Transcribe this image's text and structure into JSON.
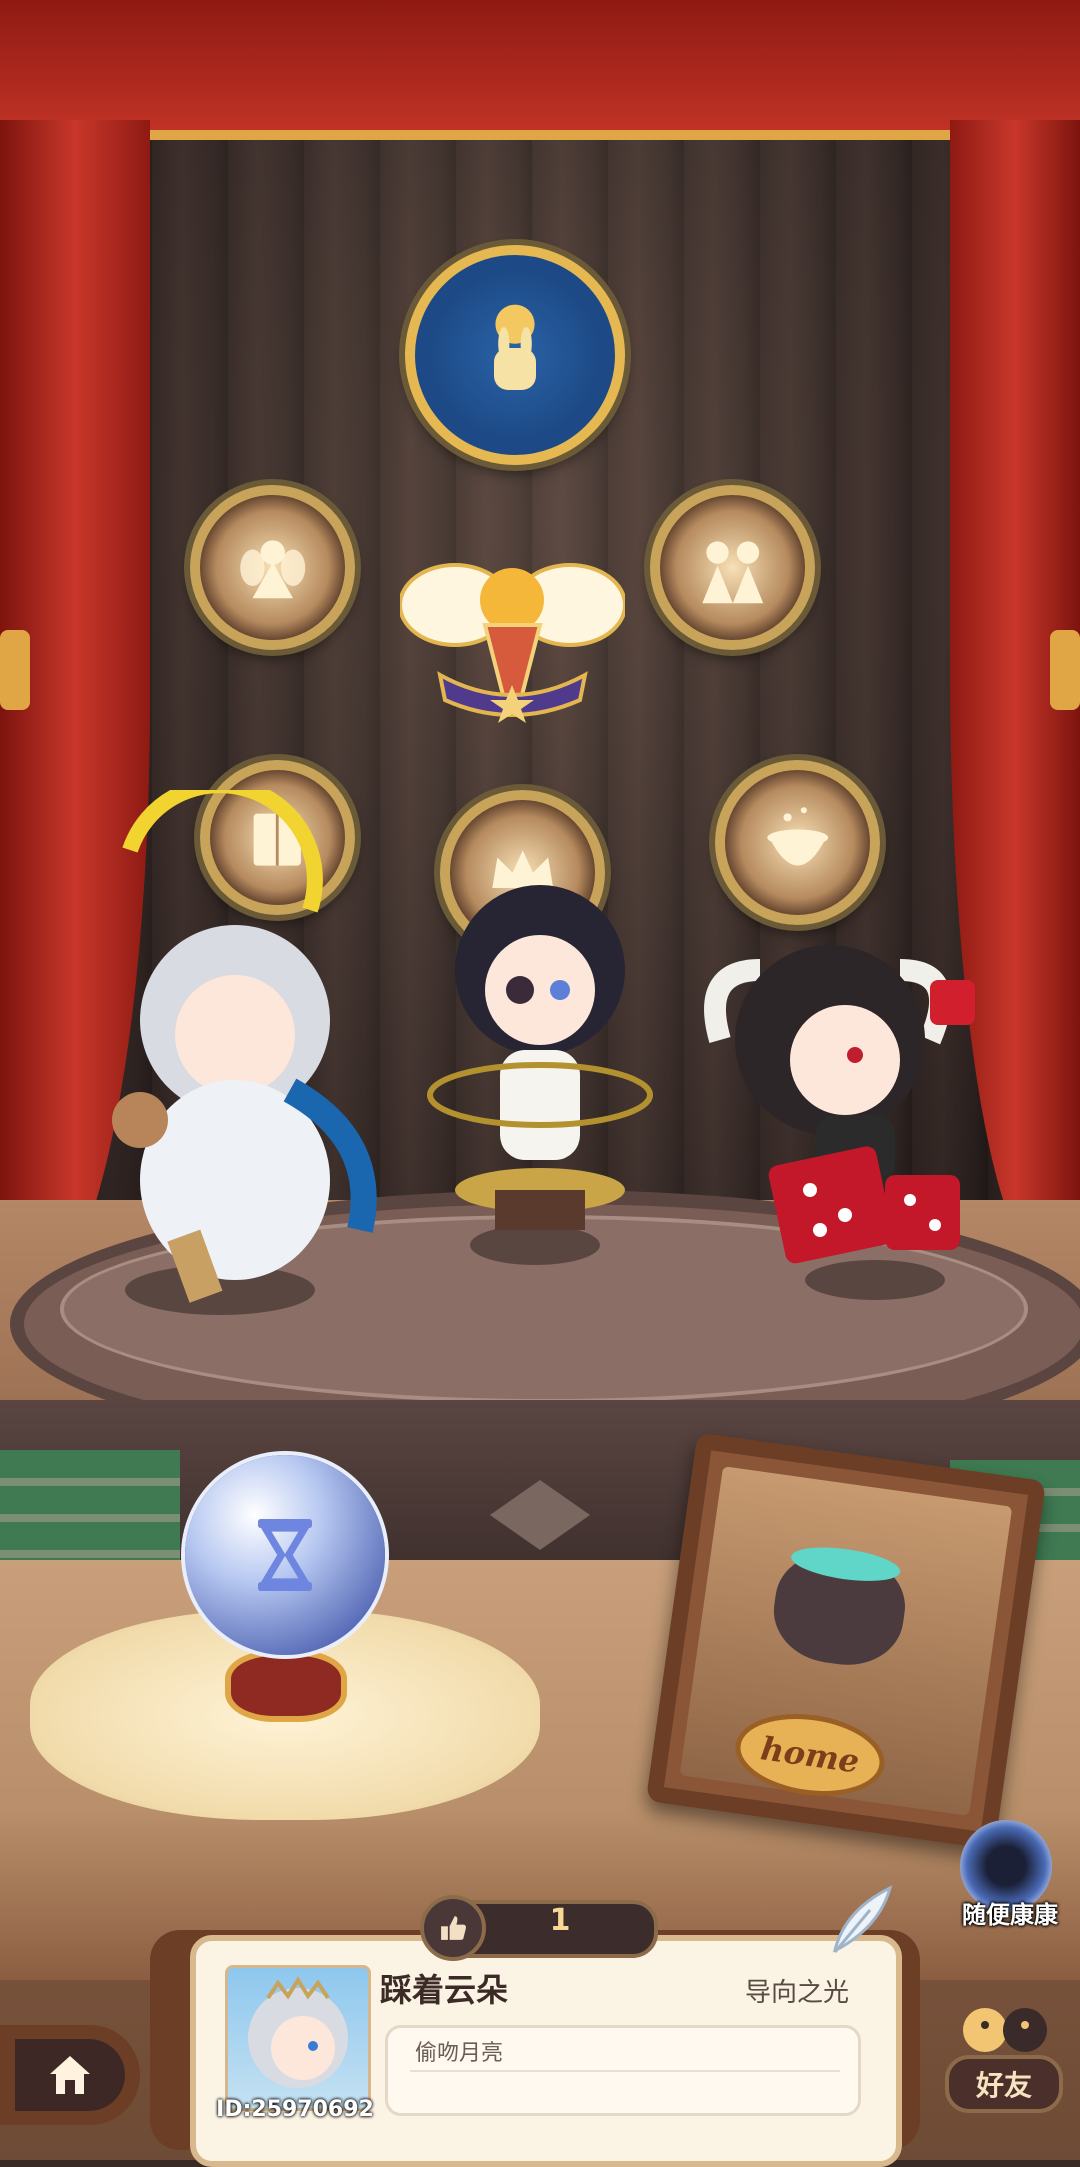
{
  "stage": {
    "badges": [
      {
        "name": "moon-rabbit-badge"
      },
      {
        "name": "fairy-badge"
      },
      {
        "name": "winged-torch-badge"
      },
      {
        "name": "twins-badge"
      },
      {
        "name": "book-badge"
      },
      {
        "name": "crown-badge"
      },
      {
        "name": "cauldron-badge"
      }
    ],
    "characters": [
      "angel-girl",
      "dark-hair-girl",
      "demon-girl"
    ]
  },
  "home_frame": {
    "label": "home"
  },
  "random_visit": {
    "label": "随便康康"
  },
  "profile": {
    "likes": "1",
    "username": "踩着云朵",
    "title": "导向之光",
    "signature": "偷吻月亮",
    "user_id": "ID:25970692"
  },
  "friends": {
    "label": "好友"
  },
  "colors": {
    "curtain": "#c03225",
    "gold": "#e0a646",
    "panel": "#6c3e25",
    "card": "#fbf3e4"
  }
}
